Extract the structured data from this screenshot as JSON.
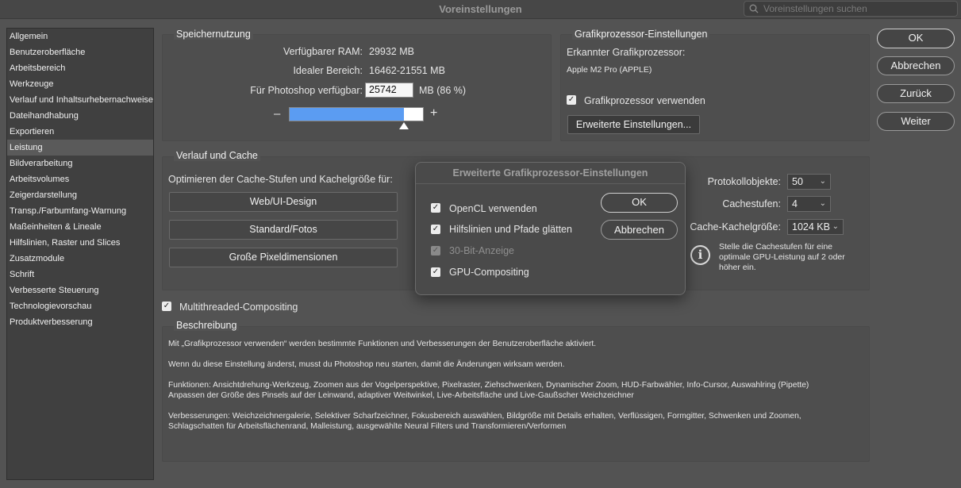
{
  "window": {
    "title": "Voreinstellungen"
  },
  "search": {
    "placeholder": "Voreinstellungen suchen"
  },
  "sidebar": {
    "items": [
      {
        "label": "Allgemein"
      },
      {
        "label": "Benutzeroberfläche"
      },
      {
        "label": "Arbeitsbereich"
      },
      {
        "label": "Werkzeuge"
      },
      {
        "label": "Verlauf und Inhaltsurhebernachweise"
      },
      {
        "label": "Dateihandhabung"
      },
      {
        "label": "Exportieren"
      },
      {
        "label": "Leistung",
        "selected": true
      },
      {
        "label": "Bildverarbeitung"
      },
      {
        "label": "Arbeitsvolumes"
      },
      {
        "label": "Zeigerdarstellung"
      },
      {
        "label": "Transp./Farbumfang-Warnung"
      },
      {
        "label": "Maßeinheiten & Lineale"
      },
      {
        "label": "Hilfslinien, Raster und Slices"
      },
      {
        "label": "Zusatzmodule"
      },
      {
        "label": "Schrift"
      },
      {
        "label": "Verbesserte Steuerung"
      },
      {
        "label": "Technologievorschau"
      },
      {
        "label": "Produktverbesserung"
      }
    ]
  },
  "memory": {
    "title": "Speichernutzung",
    "available_label": "Verfügbarer RAM:",
    "available_value": "29932 MB",
    "ideal_label": "Idealer Bereich:",
    "ideal_value": "16462-21551 MB",
    "ps_label": "Für Photoshop verfügbar:",
    "ps_value": "25742",
    "ps_unit": "MB (86 %)",
    "minus": "–",
    "plus": "+",
    "slider_fraction": 0.86
  },
  "gpu": {
    "title": "Grafikprozessor-Einstellungen",
    "detected_label": "Erkannter Grafikprozessor:",
    "detected_value": "Apple M2 Pro (APPLE)",
    "use_label": "Grafikprozessor verwenden",
    "use_checked": true,
    "advanced_button": "Erweiterte Einstellungen..."
  },
  "actions": {
    "ok": "OK",
    "cancel": "Abbrechen",
    "back": "Zurück",
    "next": "Weiter"
  },
  "cache": {
    "title": "Verlauf und Cache",
    "optimize_label": "Optimieren der Cache-Stufen und Kachelgröße für:",
    "buttons": [
      "Web/UI-Design",
      "Standard/Fotos",
      "Große Pixeldimensionen"
    ],
    "history_label": "Protokollobjekte:",
    "history_value": "50",
    "levels_label": "Cachestufen:",
    "levels_value": "4",
    "tile_label": "Cache-Kachelgröße:",
    "tile_value": "1024 KB",
    "info_text": "Stelle die Cachestufen für eine optimale GPU-Leistung auf 2 oder höher ein."
  },
  "multithreaded": {
    "label": "Multithreaded-Compositing",
    "checked": true
  },
  "description": {
    "title": "Beschreibung",
    "p1": "Mit „Grafikprozessor verwenden“ werden bestimmte Funktionen und Verbesserungen der Benutzeroberfläche aktiviert.",
    "p2": "Wenn du diese Einstellung änderst, musst du Photoshop neu starten, damit die Änderungen wirksam werden.",
    "p3a": "Funktionen: Ansichtdrehung-Werkzeug, Zoomen aus der Vogelperspektive, Pixelraster, Ziehschwenken, Dynamischer Zoom, HUD-Farbwähler, Info-Cursor, Auswahlring (Pipette)",
    "p3b": "Anpassen der Größe des Pinsels auf der Leinwand, adaptiver Weitwinkel, Live-Arbeitsfläche und Live-Gaußscher Weichzeichner",
    "p4a": "Verbesserungen: Weichzeichnergalerie, Selektiver Scharfzeichner, Fokusbereich auswählen, Bildgröße mit Details erhalten, Verflüssigen, Formgitter, Schwenken und Zoomen,",
    "p4b": "Schlagschatten für Arbeitsflächenrand, Malleistung, ausgewählte Neural Filters und Transformieren/Verformen"
  },
  "dialog": {
    "title": "Erweiterte Grafikprozessor-Einstellungen",
    "opencl": "OpenCL verwenden",
    "antialias": "Hilfslinien und Pfade glätten",
    "bit30": "30-Bit-Anzeige",
    "compositing": "GPU-Compositing",
    "ok": "OK",
    "cancel": "Abbrechen"
  }
}
